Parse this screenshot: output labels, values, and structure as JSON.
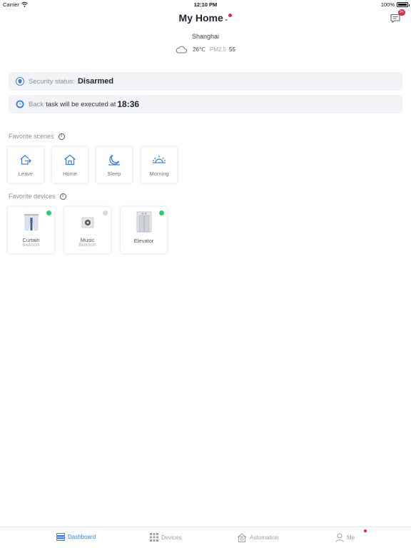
{
  "status_bar": {
    "carrier": "Carrier",
    "time": "12:10 PM",
    "battery": "100%"
  },
  "header": {
    "title": "My Home",
    "message_badge": "9+"
  },
  "weather": {
    "city": "Shanghai",
    "temperature": "26℃",
    "pm_label": "PM2.5",
    "pm_value": "55"
  },
  "security": {
    "label": "Security status:",
    "value": "Disarmed"
  },
  "task": {
    "scene": "Back",
    "text": "task will be executed at",
    "time": "18:36"
  },
  "favorite_scenes": {
    "title": "Favorite scenes",
    "items": [
      {
        "label": "Leave",
        "icon": "leave-icon"
      },
      {
        "label": "Home",
        "icon": "home-icon"
      },
      {
        "label": "Sleep",
        "icon": "sleep-icon"
      },
      {
        "label": "Morning",
        "icon": "morning-icon"
      }
    ]
  },
  "favorite_devices": {
    "title": "Favorite devices",
    "items": [
      {
        "name": "Curtain",
        "room": "Bedroom",
        "status_color": "#2ecc71",
        "icon": "curtain-icon"
      },
      {
        "name": "Music",
        "room": "Bedroom",
        "status_color": "#d8d8d8",
        "icon": "speaker-icon"
      },
      {
        "name": "Elevator",
        "room": "",
        "status_color": "#2ecc71",
        "icon": "elevator-icon"
      }
    ]
  },
  "tabbar": {
    "tabs": [
      {
        "label": "Dashboard",
        "active": true
      },
      {
        "label": "Devices",
        "active": false
      },
      {
        "label": "Automation",
        "active": false
      },
      {
        "label": "Me",
        "active": false
      }
    ]
  },
  "colors": {
    "accent": "#3d7ee6",
    "alert": "#e8214a",
    "online": "#2ecc71",
    "offline": "#d8d8d8"
  }
}
